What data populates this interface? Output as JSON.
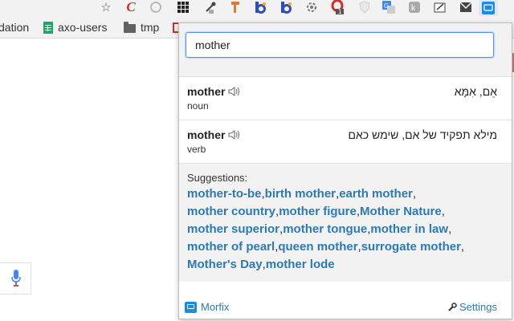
{
  "bookmarks": {
    "items": [
      {
        "label": "dation"
      },
      {
        "label": "axo-users",
        "icon": "sheets-icon"
      },
      {
        "label": "tmp",
        "icon": "folder-icon"
      }
    ]
  },
  "toolbar": {
    "extension_badge": "1"
  },
  "popup": {
    "search": {
      "value": "mother"
    },
    "entries": [
      {
        "word": "mother",
        "pos": "noun",
        "translation": "אֵם, אִמָּא"
      },
      {
        "word": "mother",
        "pos": "verb",
        "translation": "מילא תפקיד של אם, שימש כאם"
      }
    ],
    "suggestions": {
      "title": "Suggestions:",
      "lines": [
        [
          "mother-to-be",
          "birth mother",
          "earth mother"
        ],
        [
          "mother country",
          "mother figure",
          "Mother Nature"
        ],
        [
          "mother superior",
          "mother tongue",
          "mother in law"
        ],
        [
          "mother of pearl",
          "queen mother",
          "surrogate mother"
        ],
        [
          "Mother's Day",
          "mother lode"
        ]
      ]
    },
    "footer": {
      "brand": "Morfix",
      "settings": "Settings"
    }
  },
  "colors": {
    "link": "#2a7ab6",
    "input_focus": "#4d90fe",
    "panel_bg": "#f2f2f2"
  }
}
